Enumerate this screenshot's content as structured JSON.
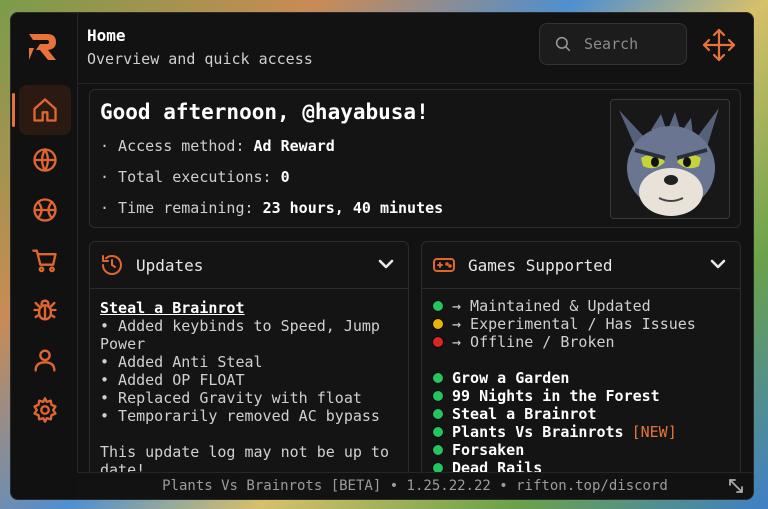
{
  "header": {
    "title": "Home",
    "subtitle": "Overview and quick access",
    "search_placeholder": "Search"
  },
  "sidebar": {
    "items": [
      {
        "name": "home",
        "icon": "home-icon",
        "active": true
      },
      {
        "name": "globe",
        "icon": "globe-icon",
        "active": false
      },
      {
        "name": "ball",
        "icon": "ball-icon",
        "active": false
      },
      {
        "name": "shop",
        "icon": "cart-icon",
        "active": false
      },
      {
        "name": "bug",
        "icon": "bug-icon",
        "active": false
      },
      {
        "name": "user",
        "icon": "user-icon",
        "active": false
      },
      {
        "name": "settings",
        "icon": "gear-icon",
        "active": false
      }
    ]
  },
  "welcome": {
    "greeting": "Good afternoon, @hayabusa!",
    "access_label": "· Access method: ",
    "access_value": "Ad Reward",
    "exec_label": "· Total executions: ",
    "exec_value": "0",
    "time_label": "· Time remaining: ",
    "time_value": "23 hours, 40 minutes"
  },
  "updates": {
    "title": "Updates",
    "heading": "Steal a Brainrot",
    "lines": [
      "• Added keybinds to Speed, Jump Power",
      "• Added Anti Steal",
      "• Added OP FLOAT",
      "• Replaced Gravity with float",
      "• Temporarily removed AC bypass"
    ],
    "note": "This update log may not be up to date!"
  },
  "games": {
    "title": "Games Supported",
    "legend": [
      {
        "color": "#22c55e",
        "text": "→ Maintained & Updated"
      },
      {
        "color": "#eab308",
        "text": "→ Experimental / Has Issues"
      },
      {
        "color": "#dc2626",
        "text": "→ Offline / Broken"
      }
    ],
    "list": [
      {
        "name": "Grow a Garden",
        "color": "#22c55e",
        "tag": ""
      },
      {
        "name": "99 Nights in the Forest",
        "color": "#22c55e",
        "tag": ""
      },
      {
        "name": "Steal a Brainrot",
        "color": "#22c55e",
        "tag": ""
      },
      {
        "name": "Plants Vs Brainrots",
        "color": "#22c55e",
        "tag": "[NEW]"
      },
      {
        "name": "Forsaken",
        "color": "#22c55e",
        "tag": ""
      },
      {
        "name": "Dead Rails",
        "color": "#22c55e",
        "tag": ""
      }
    ]
  },
  "footer": {
    "text": "Plants Vs Brainrots [BETA] • 1.25.22.22 • rifton.top/discord"
  },
  "colors": {
    "accent": "#e8733a",
    "background": "#121212"
  }
}
